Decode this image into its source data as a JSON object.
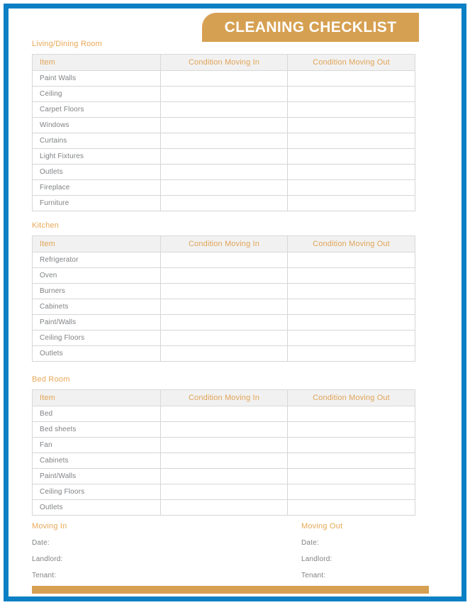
{
  "document": {
    "title": "CLEANING CHECKLIST"
  },
  "theme": {
    "banner_color": "#d6a052",
    "frame_color": "#0b80c4",
    "accent_color": "#e8a857",
    "header_row_bg": "#f1f1f1",
    "text_color": "#7f8184"
  },
  "table_headers": {
    "item": "Item",
    "moving_in": "Condition Moving In",
    "moving_out": "Condition Moving Out"
  },
  "sections": [
    {
      "label": "Living/Dining Room",
      "rows": [
        "Paint Walls",
        "Ceiling",
        "Carpet Floors",
        "Windows",
        "Curtains",
        "Light Fixtures",
        "Outlets",
        "Fireplace",
        "Furniture"
      ]
    },
    {
      "label": "Kitchen",
      "rows": [
        "Refrigerator",
        "Oven",
        "Burners",
        "Cabinets",
        "Paint/Walls",
        "Ceiling Floors",
        "Outlets"
      ]
    },
    {
      "label": "Bed Room",
      "rows": [
        "Bed",
        "Bed sheets",
        "Fan",
        "Cabinets",
        "Paint/Walls",
        "Ceiling Floors",
        "Outlets"
      ]
    }
  ],
  "footer": {
    "moving_in": {
      "title": "Moving In",
      "fields": [
        "Date:",
        "Landlord:",
        "Tenant:"
      ]
    },
    "moving_out": {
      "title": "Moving Out",
      "fields": [
        "Date:",
        "Landlord:",
        "Tenant:"
      ]
    }
  }
}
